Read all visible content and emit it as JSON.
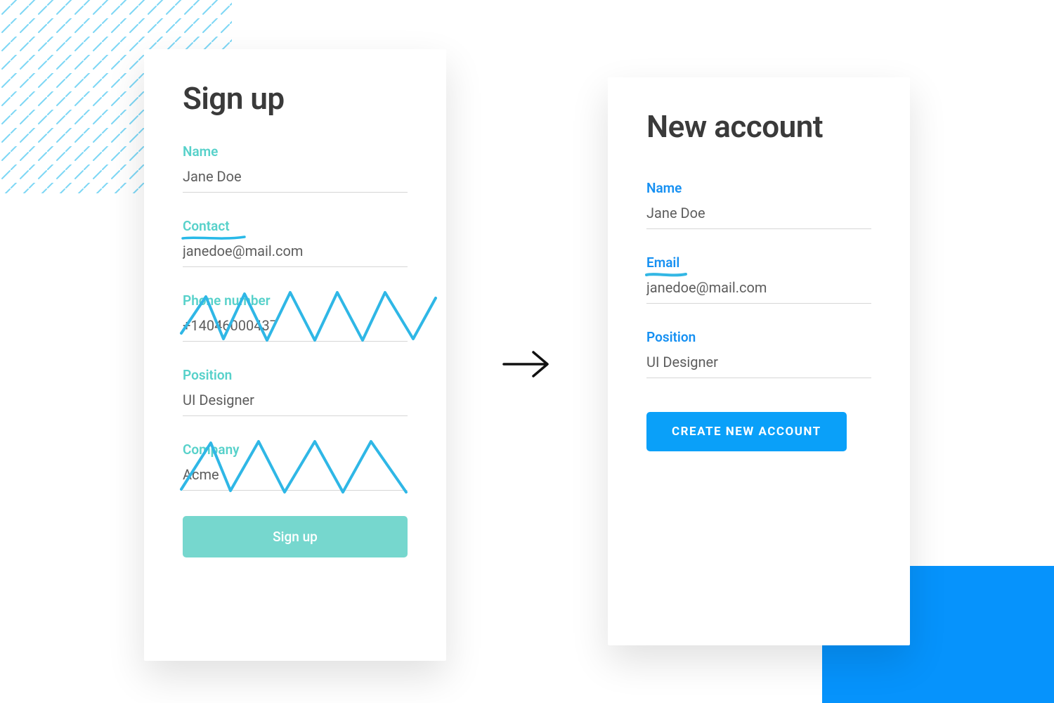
{
  "left_card": {
    "title": "Sign up",
    "fields": {
      "name": {
        "label": "Name",
        "value": "Jane Doe"
      },
      "contact": {
        "label": "Contact",
        "value": "janedoe@mail.com"
      },
      "phone": {
        "label": "Phone number",
        "value": "+14046000437"
      },
      "position": {
        "label": "Position",
        "value": "UI Designer"
      },
      "company": {
        "label": "Company",
        "value": "Acme"
      }
    },
    "button_label": "Sign up"
  },
  "right_card": {
    "title": "New account",
    "fields": {
      "name": {
        "label": "Name",
        "value": "Jane Doe"
      },
      "email": {
        "label": "Email",
        "value": "janedoe@mail.com"
      },
      "position": {
        "label": "Position",
        "value": "UI Designer"
      }
    },
    "button_label": "CREATE NEW ACCOUNT"
  },
  "colors": {
    "teal": "#57d1ca",
    "blue": "#0aa0f9",
    "bright_blue": "#0693fc"
  }
}
